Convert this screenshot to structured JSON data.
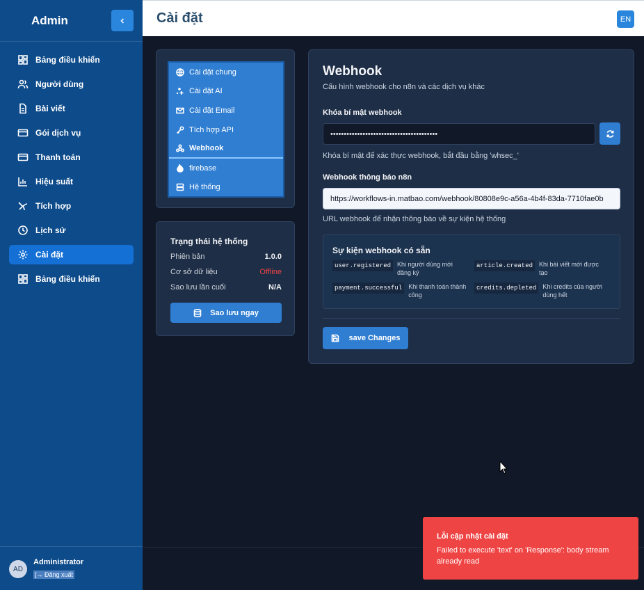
{
  "sidebar": {
    "brand": "Admin",
    "collapse_icon": "chevron-left-icon",
    "items": [
      {
        "label": "Bảng điều khiển",
        "icon": "dashboard-icon"
      },
      {
        "label": "Người dùng",
        "icon": "users-icon"
      },
      {
        "label": "Bài viết",
        "icon": "document-icon"
      },
      {
        "label": "Gói dịch vụ",
        "icon": "card-icon"
      },
      {
        "label": "Thanh toán",
        "icon": "card-icon"
      },
      {
        "label": "Hiệu suất",
        "icon": "bar-chart-icon"
      },
      {
        "label": "Tích hợp",
        "icon": "plug-icon"
      },
      {
        "label": "Lịch sử",
        "icon": "clock-icon"
      },
      {
        "label": "Cài đặt",
        "icon": "gear-icon",
        "active": true
      },
      {
        "label": "Bảng điều khiển",
        "icon": "dashboard-icon"
      }
    ],
    "user": {
      "initials": "AD",
      "name": "Administrator",
      "logout": "[→ Đăng xuất"
    }
  },
  "header": {
    "title": "Cài đặt",
    "lang": "EN"
  },
  "settings_menu": [
    {
      "label": "Cài đặt chung",
      "icon": "globe-icon"
    },
    {
      "label": "Cài đặt AI",
      "icon": "sparkles-icon"
    },
    {
      "label": "Cài đặt Email",
      "icon": "mail-icon"
    },
    {
      "label": "Tích hợp API",
      "icon": "key-icon"
    },
    {
      "label": "Webhook",
      "icon": "webhook-icon",
      "active": true
    },
    {
      "label": "firebase",
      "icon": "flame-icon"
    },
    {
      "label": "Hệ thống",
      "icon": "server-icon"
    }
  ],
  "status": {
    "title": "Trạng thái hệ thống",
    "rows": [
      {
        "label": "Phiên bản",
        "value": "1.0.0"
      },
      {
        "label": "Cơ sở dữ liệu",
        "value": "Offline"
      },
      {
        "label": "Sao lưu lần cuối",
        "value": "N/A"
      }
    ],
    "backup_label": "Sao lưu ngay"
  },
  "webhook": {
    "title": "Webhook",
    "subtitle": "Cấu hình webhook cho n8n và các dịch vụ khác",
    "secret_label": "Khóa bí mật webhook",
    "secret_value": "••••••••••••••••••••••••••••••••••••••••",
    "secret_hint": "Khóa bí mật để xác thực webhook, bắt đầu bằng 'whsec_'",
    "url_label": "Webhook thông báo n8n",
    "url_value": "https://workflows-in.matbao.com/webhook/80808e9c-a56a-4b4f-83da-7710fae0b",
    "url_hint": "URL webhook để nhận thông báo về sự kiện hệ thống",
    "events_title": "Sự kiện webhook có sẵn",
    "events": [
      {
        "code": "user.registered",
        "desc": "Khi người dùng mới đăng ký"
      },
      {
        "code": "article.created",
        "desc": "Khi bài viết mới được tạo"
      },
      {
        "code": "payment.successful",
        "desc": "Khi thanh toán thành công"
      },
      {
        "code": "credits.depleted",
        "desc": "Khi credits của người dùng hết"
      }
    ],
    "save_label": "save Changes"
  },
  "toast": {
    "title": "Lỗi cập nhật cài đặt",
    "message": "Failed to execute 'text' on 'Response': body stream already read",
    "color": "#ef4444"
  }
}
